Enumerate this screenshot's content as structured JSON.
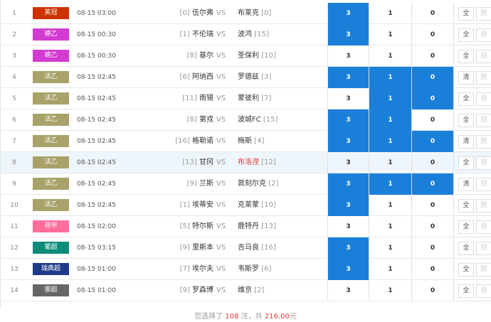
{
  "rows": [
    {
      "num": "1",
      "league": "英冠",
      "league_color": "#cc3300",
      "time": "08-15 03:00",
      "home_rank": "[0]",
      "home": "伍尔弗",
      "vs": "VS",
      "away": "布莱克",
      "away_rank": "[0]",
      "away_red": false,
      "o1": "3",
      "o2": "1",
      "o3": "0",
      "sel": [
        true,
        false,
        false
      ],
      "btn_all": "全",
      "btn_x": "胆",
      "hl": false
    },
    {
      "num": "2",
      "league": "德乙",
      "league_color": "#d23bd1",
      "time": "08-15 00:30",
      "home_rank": "[1]",
      "home": "不伦瑞",
      "vs": "VS",
      "away": "波鸿",
      "away_rank": "[15]",
      "away_red": false,
      "o1": "3",
      "o2": "1",
      "o3": "0",
      "sel": [
        true,
        false,
        false
      ],
      "btn_all": "全",
      "btn_x": "胆",
      "hl": false
    },
    {
      "num": "3",
      "league": "德乙",
      "league_color": "#d23bd1",
      "time": "08-15 00:30",
      "home_rank": "[8]",
      "home": "基尔",
      "vs": "VS",
      "away": "圣保利",
      "away_rank": "[10]",
      "away_red": false,
      "o1": "3",
      "o2": "1",
      "o3": "0",
      "sel": [
        false,
        false,
        false
      ],
      "btn_all": "全",
      "btn_x": "胆",
      "hl": false
    },
    {
      "num": "4",
      "league": "法乙",
      "league_color": "#a8a26a",
      "time": "08-15 02:45",
      "home_rank": "[6]",
      "home": "阿纳西",
      "vs": "VS",
      "away": "罗德兹",
      "away_rank": "[3]",
      "away_red": false,
      "o1": "3",
      "o2": "1",
      "o3": "0",
      "sel": [
        true,
        true,
        true
      ],
      "btn_all": "清",
      "btn_x": "胆",
      "hl": false
    },
    {
      "num": "5",
      "league": "法乙",
      "league_color": "#a8a26a",
      "time": "08-15 02:45",
      "home_rank": "[11]",
      "home": "南锡",
      "vs": "VS",
      "away": "蒙彼利",
      "away_rank": "[7]",
      "away_red": false,
      "o1": "3",
      "o2": "1",
      "o3": "0",
      "sel": [
        false,
        true,
        true
      ],
      "btn_all": "全",
      "btn_x": "胆",
      "hl": false
    },
    {
      "num": "6",
      "league": "法乙",
      "league_color": "#a8a26a",
      "time": "08-15 02:45",
      "home_rank": "[8]",
      "home": "第戎",
      "vs": "VS",
      "away": "波城FC",
      "away_rank": "[15]",
      "away_red": false,
      "o1": "3",
      "o2": "1",
      "o3": "0",
      "sel": [
        true,
        true,
        false
      ],
      "btn_all": "全",
      "btn_x": "胆",
      "hl": false
    },
    {
      "num": "7",
      "league": "法乙",
      "league_color": "#a8a26a",
      "time": "08-15 02:45",
      "home_rank": "[16]",
      "home": "格勒诺",
      "vs": "VS",
      "away": "梅斯",
      "away_rank": "[4]",
      "away_red": false,
      "o1": "3",
      "o2": "1",
      "o3": "0",
      "sel": [
        true,
        true,
        true
      ],
      "btn_all": "清",
      "btn_x": "胆",
      "hl": false
    },
    {
      "num": "8",
      "league": "法乙",
      "league_color": "#a8a26a",
      "time": "08-15 02:45",
      "home_rank": "[13]",
      "home": "甘冈",
      "vs": "VS",
      "away": "布洛涅",
      "away_rank": "[12]",
      "away_red": true,
      "o1": "3",
      "o2": "1",
      "o3": "0",
      "sel": [
        false,
        false,
        false
      ],
      "btn_all": "全",
      "btn_x": "胆",
      "hl": true
    },
    {
      "num": "9",
      "league": "法乙",
      "league_color": "#a8a26a",
      "time": "08-15 02:45",
      "home_rank": "[9]",
      "home": "兰斯",
      "vs": "VS",
      "away": "敦刻尔克",
      "away_rank": "[2]",
      "away_red": false,
      "o1": "3",
      "o2": "1",
      "o3": "0",
      "sel": [
        true,
        true,
        true
      ],
      "btn_all": "清",
      "btn_x": "胆",
      "hl": false
    },
    {
      "num": "10",
      "league": "法乙",
      "league_color": "#a8a26a",
      "time": "08-15 02:45",
      "home_rank": "[1]",
      "home": "埃蒂安",
      "vs": "VS",
      "away": "克莱蒙",
      "away_rank": "[10]",
      "away_red": false,
      "o1": "3",
      "o2": "1",
      "o3": "0",
      "sel": [
        true,
        false,
        false
      ],
      "btn_all": "全",
      "btn_x": "胆",
      "hl": false
    },
    {
      "num": "11",
      "league": "荷甲",
      "league_color": "#ff6e9b",
      "time": "08-15 02:00",
      "home_rank": "[5]",
      "home": "特尔斯",
      "vs": "VS",
      "away": "鹿特丹",
      "away_rank": "[13]",
      "away_red": false,
      "o1": "3",
      "o2": "1",
      "o3": "0",
      "sel": [
        false,
        false,
        false
      ],
      "btn_all": "全",
      "btn_x": "胆",
      "hl": false
    },
    {
      "num": "12",
      "league": "葡超",
      "league_color": "#0e8c7a",
      "time": "08-15 03:15",
      "home_rank": "[9]",
      "home": "里斯本",
      "vs": "VS",
      "away": "吉马良",
      "away_rank": "[16]",
      "away_red": false,
      "o1": "3",
      "o2": "1",
      "o3": "0",
      "sel": [
        true,
        false,
        false
      ],
      "btn_all": "全",
      "btn_x": "胆",
      "hl": false
    },
    {
      "num": "13",
      "league": "瑞典超",
      "league_color": "#1e3a8a",
      "time": "08-15 01:00",
      "home_rank": "[7]",
      "home": "埃尔夫",
      "vs": "VS",
      "away": "韦斯罗",
      "away_rank": "[6]",
      "away_red": false,
      "o1": "3",
      "o2": "1",
      "o3": "0",
      "sel": [
        true,
        false,
        false
      ],
      "btn_all": "全",
      "btn_x": "胆",
      "hl": false
    },
    {
      "num": "14",
      "league": "挪超",
      "league_color": "#666666",
      "time": "08-15 01:00",
      "home_rank": "[9]",
      "home": "罗森博",
      "vs": "VS",
      "away": "维京",
      "away_rank": "[2]",
      "away_red": false,
      "o1": "3",
      "o2": "1",
      "o3": "0",
      "sel": [
        false,
        false,
        false
      ],
      "btn_all": "全",
      "btn_x": "胆",
      "hl": false
    }
  ],
  "footer": {
    "prefix": "您选择了 ",
    "count": "108",
    "mid": " 注，共 ",
    "amount": "216.00",
    "suffix": "元"
  },
  "colors": {
    "selected_blue": "#1a7fd8",
    "highlight_red": "#e4393c"
  }
}
